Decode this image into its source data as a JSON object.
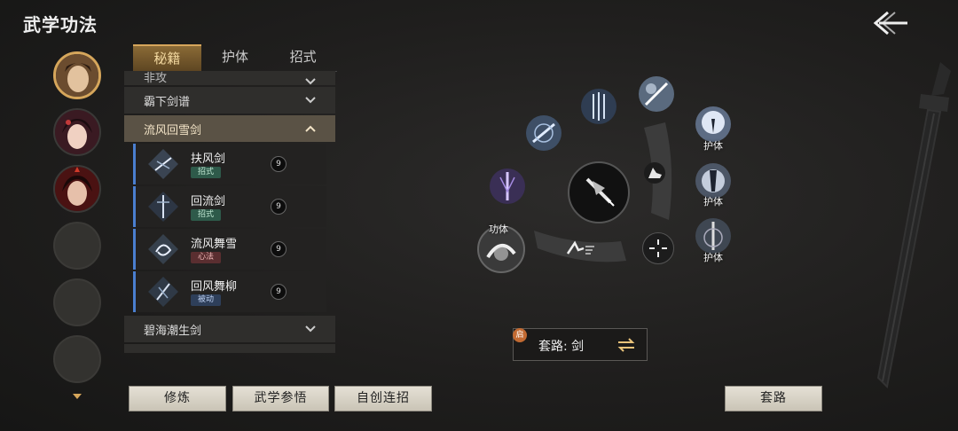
{
  "header": {
    "title": "武学功法"
  },
  "tabs": [
    {
      "label": "秘籍",
      "active": true
    },
    {
      "label": "护体",
      "active": false
    },
    {
      "label": "招式",
      "active": false
    }
  ],
  "categories": {
    "partial": "非攻",
    "c1": "霸下剑谱",
    "expanded": "流风回雪剑",
    "c3": "碧海潮生剑"
  },
  "skills": [
    {
      "name": "扶风剑",
      "tag": "招式",
      "badge": "9"
    },
    {
      "name": "回流剑",
      "tag": "招式",
      "badge": "9"
    },
    {
      "name": "流风舞雪",
      "tag": "心法",
      "badge": "9"
    },
    {
      "name": "回风舞柳",
      "tag": "被动",
      "badge": "9"
    }
  ],
  "wheel": {
    "label_gongti": "功体",
    "label_huti1": "护体",
    "label_huti2": "护体",
    "label_huti3": "护体"
  },
  "route": {
    "seal": "启",
    "text": "套路: 剑"
  },
  "buttons": {
    "xiulian": "修炼",
    "canwu": "武学参悟",
    "lianzhao": "自创连招",
    "taolu": "套路"
  },
  "colors": {
    "accent": "#d6a65b",
    "skill_border": "#4a7fd0"
  }
}
